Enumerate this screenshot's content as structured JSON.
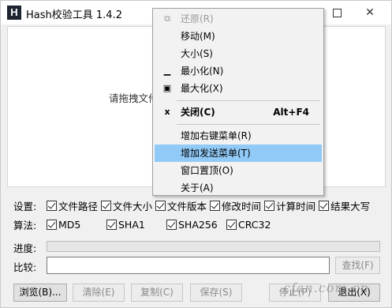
{
  "window": {
    "title": "Hash校验工具 1.4.2",
    "icon_letter": "H"
  },
  "drop_area": {
    "hint": "请拖拽文件"
  },
  "settings": {
    "label": "设置:",
    "options": [
      {
        "label": "文件路径",
        "checked": true
      },
      {
        "label": "文件大小",
        "checked": true
      },
      {
        "label": "文件版本",
        "checked": true
      },
      {
        "label": "修改时间",
        "checked": true
      },
      {
        "label": "计算时间",
        "checked": true
      },
      {
        "label": "结果大写",
        "checked": true
      }
    ]
  },
  "algorithms": {
    "label": "算法:",
    "options": [
      {
        "label": "MD5",
        "checked": true
      },
      {
        "label": "SHA1",
        "checked": true
      },
      {
        "label": "SHA256",
        "checked": true
      },
      {
        "label": "CRC32",
        "checked": true
      }
    ]
  },
  "progress": {
    "label": "进度:",
    "value": 0
  },
  "compare": {
    "label": "比较:",
    "value": "",
    "find_label": "查找(F)"
  },
  "buttons": {
    "browse": "浏览(B)...",
    "clear": "清除(E)",
    "copy": "复制(C)",
    "save": "保存(S)",
    "stop": "停止(P)",
    "exit": "退出(X)"
  },
  "context_menu": {
    "items": [
      {
        "label": "还原(R)",
        "glyph": "restore-icon",
        "disabled": true
      },
      {
        "label": "移动(M)"
      },
      {
        "label": "大小(S)"
      },
      {
        "label": "最小化(N)",
        "glyph": "minimize-icon"
      },
      {
        "label": "最大化(X)",
        "glyph": "maximize-icon"
      },
      {
        "label": "关闭(C)",
        "glyph": "close-icon",
        "accel": "Alt+F4",
        "bold": true
      },
      {
        "label": "增加右键菜单(R)"
      },
      {
        "label": "增加发送菜单(T)",
        "highlighted": true
      },
      {
        "label": "窗口置顶(O)"
      },
      {
        "label": "关于(A)"
      }
    ]
  },
  "colors": {
    "menu_highlight": "#91c9f7",
    "progress_fill": "#06b025"
  }
}
